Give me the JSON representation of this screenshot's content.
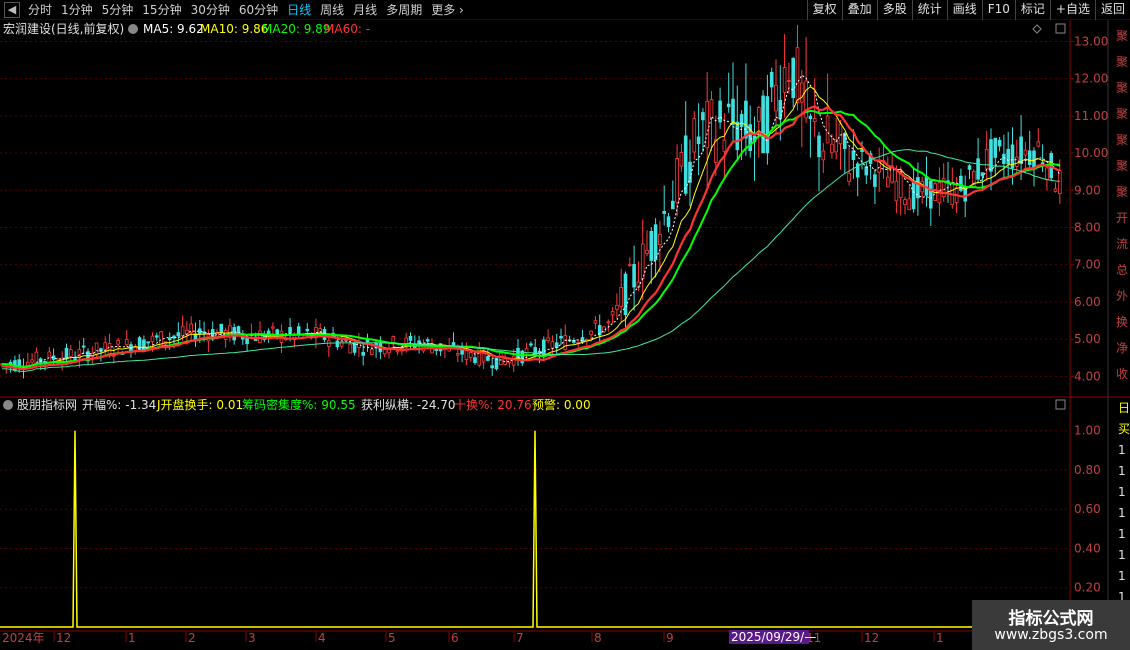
{
  "toolbar": {
    "periods": [
      "分时",
      "1分钟",
      "5分钟",
      "15分钟",
      "30分钟",
      "60分钟",
      "日线",
      "周线",
      "月线",
      "多周期",
      "更多"
    ],
    "active_period": "日线",
    "buttons": [
      "复权",
      "叠加",
      "多股",
      "统计",
      "画线",
      "F10",
      "标记",
      "+自选",
      "返回"
    ]
  },
  "main_panel": {
    "title": "宏润建设(日线,前复权)",
    "ma_labels": [
      {
        "text": "MA5: 9.62",
        "color": "#ffffff"
      },
      {
        "text": "MA10: 9.86",
        "color": "#ffff00"
      },
      {
        "text": "MA20: 9.89",
        "color": "#00ff00"
      },
      {
        "text": "MA60: -",
        "color": "#ff3333"
      }
    ],
    "price_axis": [
      "13.00",
      "12.00",
      "11.00",
      "10.00",
      "9.00",
      "8.00",
      "7.00",
      "6.00",
      "5.00",
      "4.00"
    ],
    "right_edge_text": [
      "聚",
      "聚",
      "聚",
      "聚",
      "聚",
      "聚",
      "聚",
      "开",
      "流",
      "总",
      "外",
      "换",
      "净",
      "收"
    ]
  },
  "indicator_panel": {
    "title": "股朋指标网",
    "labels": [
      {
        "text": "开幅%: -1.34",
        "color": "#e0e0e0"
      },
      {
        "text": "J开盘换手: 0.01",
        "color": "#ffff00"
      },
      {
        "text": "筹码密集度%: 90.55",
        "color": "#00ff00"
      },
      {
        "text": "获利纵横: -24.70",
        "color": "#e0e0e0"
      },
      {
        "text": "十换%: 20.76",
        "color": "#ff3333"
      },
      {
        "text": "预警: 0.00",
        "color": "#ffff00"
      }
    ],
    "axis": [
      "1.00",
      "0.80",
      "0.60",
      "0.40",
      "0.20"
    ],
    "right_edge_text": [
      "日",
      "买",
      "1",
      "1",
      "1",
      "1",
      "1",
      "1",
      "1",
      "1",
      "1"
    ]
  },
  "time_axis": {
    "labels": [
      "2024年",
      "12",
      "1",
      "2",
      "3",
      "4",
      "5",
      "6",
      "7",
      "8",
      "9",
      "10",
      "11",
      "12",
      "1"
    ],
    "cursor_date": "2025/09/29/—"
  },
  "watermark": {
    "title": "指标公式网",
    "url": "www.zbgs3.com"
  },
  "chart_data": {
    "type": "line",
    "series": [
      {
        "name": "MA5",
        "color": "#ffffff"
      },
      {
        "name": "MA10",
        "color": "#ffff00"
      },
      {
        "name": "MA20",
        "color": "#00ff00"
      },
      {
        "name": "MA60",
        "color": "#ff3333"
      }
    ],
    "ylim": [
      3.5,
      13.2
    ],
    "indicator_ylim": [
      0,
      1.08
    ],
    "indicator_spikes": [
      {
        "month_label": "12",
        "value": 1.0
      },
      {
        "month_label": "7",
        "value": 1.0
      }
    ]
  }
}
